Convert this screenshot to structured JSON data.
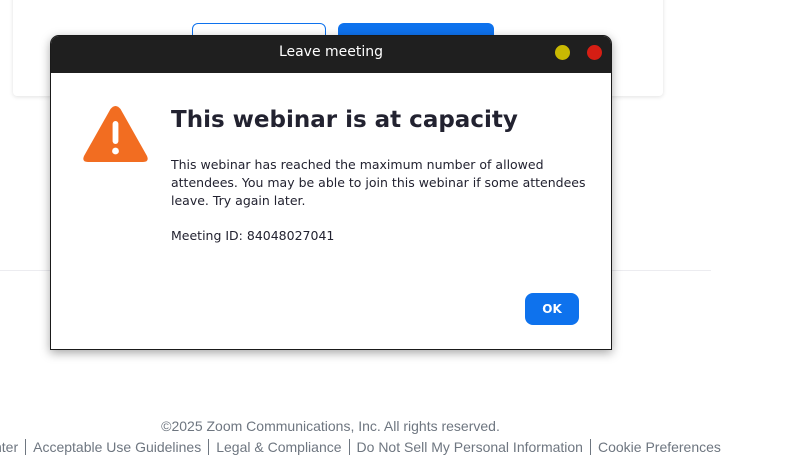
{
  "dialog": {
    "title": "Leave meeting",
    "heading": "This webinar is at capacity",
    "body": "This webinar has reached the maximum number of allowed attendees. You may be able to join this webinar if some attendees leave. Try again later.",
    "meeting_id_label": "Meeting ID: 84048027041",
    "ok_label": "OK",
    "icon": "warning-icon",
    "window_buttons": [
      "minimize",
      "close"
    ]
  },
  "footer": {
    "copyright": "©2025 Zoom Communications, Inc. All rights reserved.",
    "links": [
      "nter",
      "Acceptable Use Guidelines",
      "Legal & Compliance",
      "Do Not Sell My Personal Information",
      "Cookie Preferences"
    ]
  },
  "colors": {
    "accent": "#0e72ed",
    "warning": "#f26d21",
    "titlebar": "#1f1f1f",
    "minimize": "#c9b902",
    "close": "#d61e14"
  }
}
